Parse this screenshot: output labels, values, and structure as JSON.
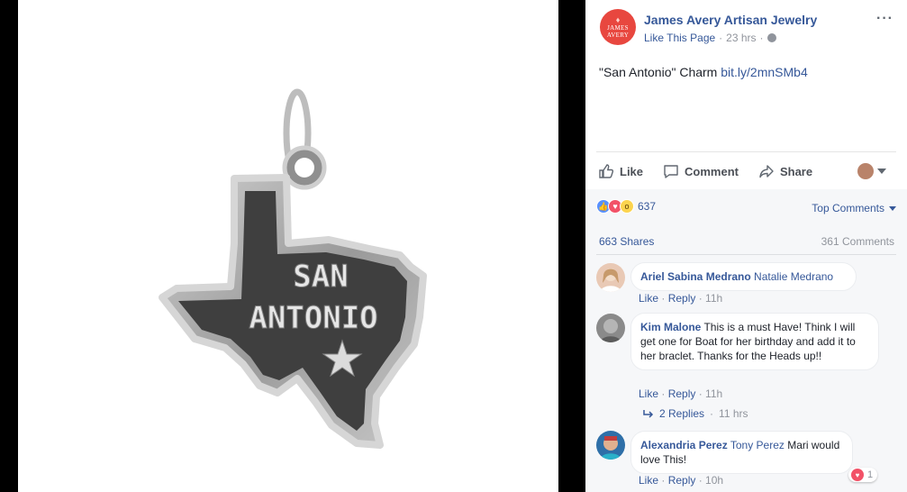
{
  "post": {
    "page_name": "James Avery Artisan Jewelry",
    "avatar_text_1": "JAMES",
    "avatar_text_2": "AVERY",
    "like_page": "Like This Page",
    "time": "23 hrs",
    "text_prefix": "\"San Antonio\" Charm ",
    "link": "bit.ly/2mnSMb4",
    "image": {
      "charm_text_line1": "SAN",
      "charm_text_line2": "ANTONIO"
    }
  },
  "actions": {
    "like": "Like",
    "comment": "Comment",
    "share": "Share"
  },
  "stats": {
    "reaction_count": "637",
    "top_comments": "Top Comments",
    "shares": "663 Shares",
    "comments": "361 Comments"
  },
  "comments": [
    {
      "author": "Ariel Sabina Medrano",
      "tag": "Natalie Medrano",
      "text": "",
      "like": "Like",
      "reply": "Reply",
      "time": "11h"
    },
    {
      "author": "Kim Malone",
      "tag": "",
      "text": "This is a must Have! Think I will get one for Boat for her birthday and add it to her braclet. Thanks for the Heads up!!",
      "like": "Like",
      "reply": "Reply",
      "time": "11h",
      "replies_label": "2 Replies",
      "replies_time": "11 hrs"
    },
    {
      "author": "Alexandria Perez",
      "tag": "Tony Perez",
      "text": "Mari would love This!",
      "like": "Like",
      "reply": "Reply",
      "time": "10h",
      "reaction_count": "1"
    }
  ],
  "colors": {
    "link": "#365899",
    "brand": "#e8473f",
    "like": "#5890ff",
    "love": "#f25268",
    "wow": "#fcd44f"
  },
  "icons": [
    "thumbs-up-icon",
    "comment-icon",
    "share-icon",
    "globe-icon",
    "more-icon",
    "caret-down-icon",
    "reply-arrow-icon",
    "heart-icon"
  ]
}
